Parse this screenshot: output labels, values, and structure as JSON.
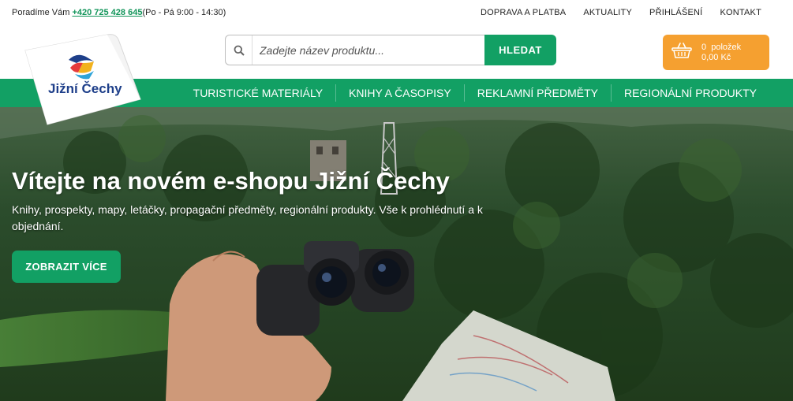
{
  "topbar": {
    "contact_prefix": "Poradíme Vám",
    "phone": "+420 725 428 645",
    "hours": "(Po - Pá 9:00 - 14:30)",
    "links": [
      "DOPRAVA A PLATBA",
      "AKTUALITY",
      "PŘIHLÁŠENÍ",
      "KONTAKT"
    ]
  },
  "logo": {
    "text": "Jižní Čechy"
  },
  "search": {
    "placeholder": "Zadejte název produktu...",
    "button_label": "HLEDAT",
    "icon": "search-icon"
  },
  "cart": {
    "icon": "basket-icon",
    "count_label": "0  položek",
    "total": "0,00 Kč"
  },
  "nav": {
    "items": [
      "TURISTICKÉ MATERIÁLY",
      "KNIHY A ČASOPISY",
      "REKLAMNÍ PŘEDMĚTY",
      "REGIONÁLNÍ PRODUKTY"
    ]
  },
  "hero": {
    "title": "Vítejte na novém e-shopu Jižní Čechy",
    "subtitle": "Knihy, prospekty, mapy, letáčky, propagační předměty, regionální produkty. Vše k prohlédnutí a k objednání.",
    "cta_label": "ZOBRAZIT VÍCE"
  },
  "colors": {
    "brand_green": "#12a064",
    "cart_orange": "#f5a030",
    "logo_blue": "#1e3f8a"
  }
}
